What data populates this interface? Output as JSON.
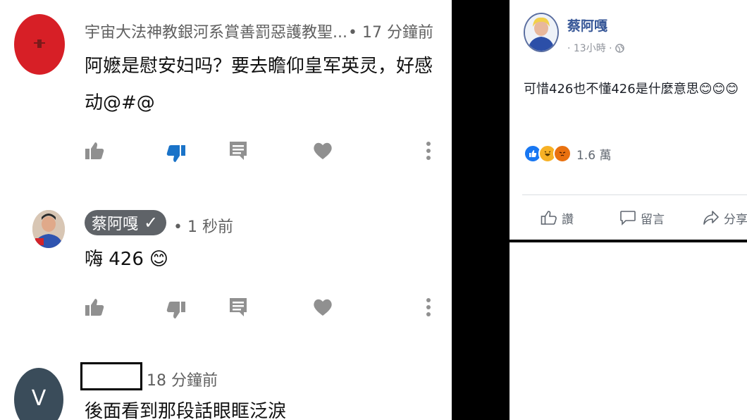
{
  "youtube": {
    "comments": [
      {
        "author": "宇宙大法神教銀河系賞善罰惡護教聖...",
        "time": "• 17 分鐘前",
        "text_line1": "阿嬷是慰安妇吗？要去瞻仰皇军英灵，好感",
        "text_line2": "动@#@",
        "avatar_color": "#d71f26",
        "actions": {
          "like": "like-icon",
          "dislike": "dislike-icon",
          "reply": "reply-icon",
          "heart": "heart-icon",
          "menu": "more-icon"
        }
      },
      {
        "author": "蔡阿嘎",
        "verified": "✓",
        "time": "• 1 秒前",
        "text": "嗨 426",
        "emoji": "😊"
      },
      {
        "author": "",
        "time": "18 分鐘前",
        "avatar_letter": "V",
        "avatar_color": "#3a4c5a",
        "text": "後面看到那段話眼眶泛淚"
      }
    ]
  },
  "facebook": {
    "author": "蔡阿嘎",
    "time": "· 13小時 ·",
    "globe_icon": "globe-icon",
    "text": "可惜426也不懂426是什麼意思😊😊😊",
    "reactions": [
      "like-reaction",
      "haha-reaction",
      "angry-reaction"
    ],
    "reaction_count": "1.6 萬",
    "buttons": {
      "like": "讚",
      "comment": "留言",
      "share": "分享"
    },
    "colors": {
      "link": "#385898",
      "like_blue": "#1877f2",
      "angry": "#e9710f",
      "haha": "#f7b125"
    }
  }
}
